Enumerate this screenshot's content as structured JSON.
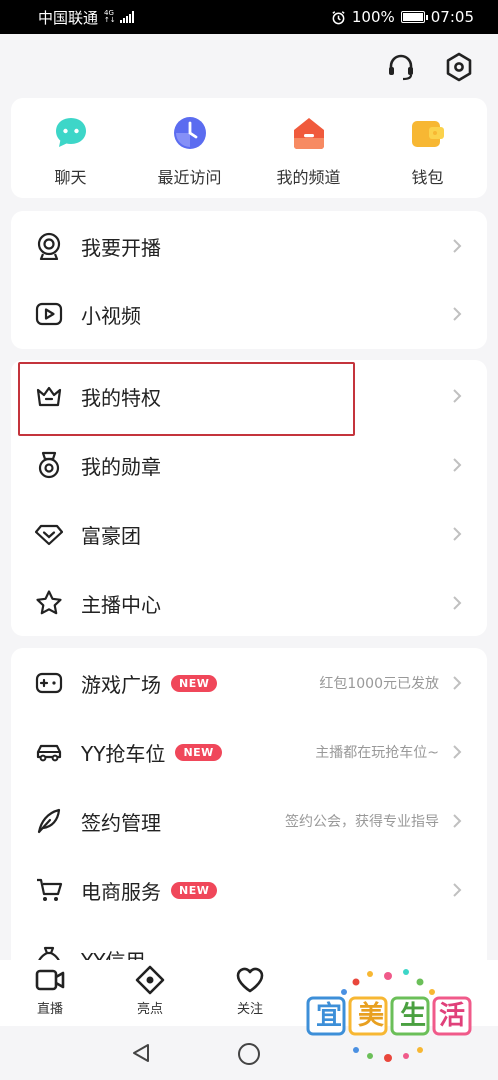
{
  "status_bar": {
    "carrier": "中国联通",
    "network": "4G",
    "battery": "100%",
    "time": "07:05"
  },
  "top_actions": [
    {
      "icon": "headset-icon"
    },
    {
      "icon": "settings-hex-icon"
    }
  ],
  "quick_actions": [
    {
      "label": "聊天",
      "icon": "chat-bubble-icon",
      "color": "#3dd6c8"
    },
    {
      "label": "最近访问",
      "icon": "clock-icon",
      "color": "#5b6cf0"
    },
    {
      "label": "我的频道",
      "icon": "channel-house-icon",
      "color": "#f05a3c"
    },
    {
      "label": "钱包",
      "icon": "wallet-icon",
      "color": "#f7b733"
    }
  ],
  "menu_group_1": [
    {
      "label": "我要开播",
      "icon": "webcam-icon"
    },
    {
      "label": "小视频",
      "icon": "video-play-icon"
    }
  ],
  "menu_group_2": [
    {
      "label": "我的特权",
      "icon": "crown-icon"
    },
    {
      "label": "我的勋章",
      "icon": "medal-icon"
    },
    {
      "label": "富豪团",
      "icon": "diamond-heart-icon"
    },
    {
      "label": "主播中心",
      "icon": "star-icon"
    }
  ],
  "menu_group_3": [
    {
      "label": "游戏广场",
      "icon": "gamepad-icon",
      "badge": "NEW",
      "sub": "红包1000元已发放"
    },
    {
      "label": "YY抢车位",
      "icon": "car-icon",
      "badge": "NEW",
      "sub": "主播都在玩抢车位~"
    },
    {
      "label": "签约管理",
      "icon": "feather-pen-icon",
      "sub": "签约公会，获得专业指导"
    },
    {
      "label": "电商服务",
      "icon": "shopping-cart-icon",
      "badge": "NEW"
    },
    {
      "label": "YY信用",
      "icon": "money-bag-icon"
    }
  ],
  "bottom_nav": [
    {
      "label": "直播",
      "icon": "live-camera-icon"
    },
    {
      "label": "亮点",
      "icon": "highlight-eye-icon"
    },
    {
      "label": "关注",
      "icon": "heart-icon"
    }
  ],
  "watermark": {
    "text": "宜美生活"
  },
  "colors": {
    "badge": "#f0475a",
    "highlight_box": "#c4343c",
    "background": "#f5f5f7"
  }
}
